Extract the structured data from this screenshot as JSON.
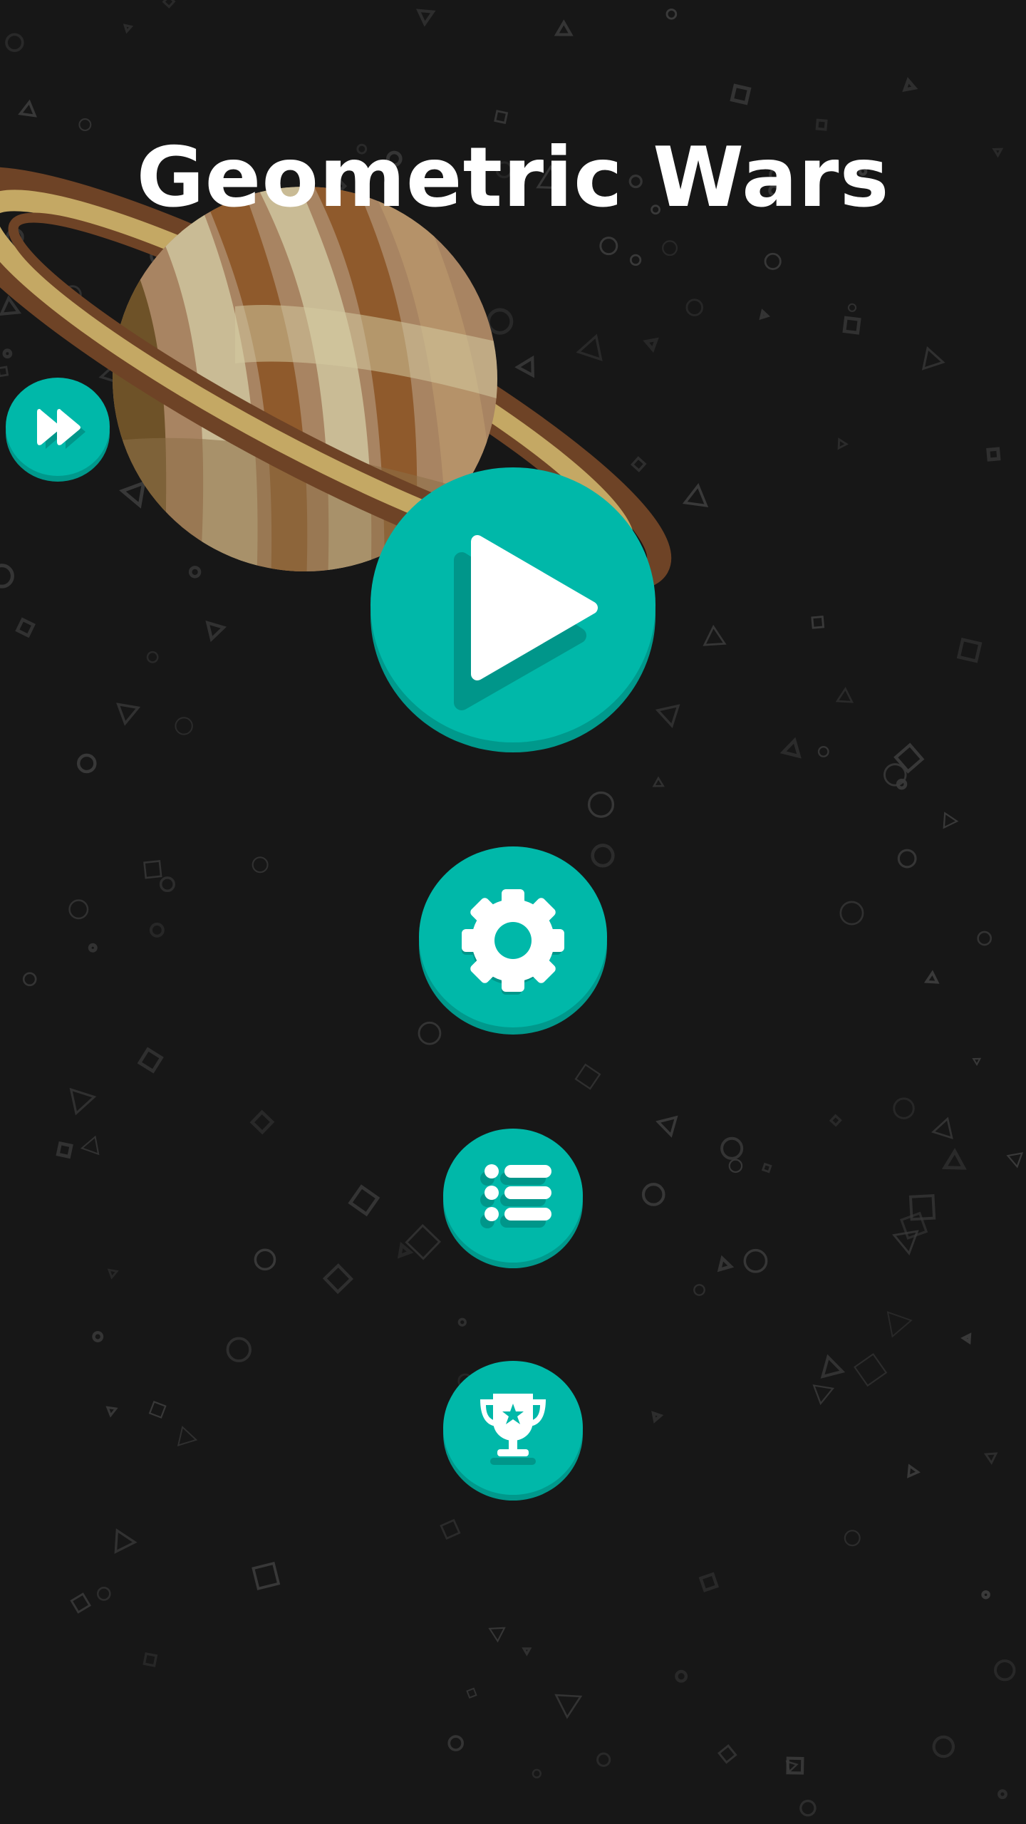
{
  "title": "Geometric Wars",
  "colors": {
    "background": "#171717",
    "button_face": "#00b8a9",
    "button_rim": "#00998c",
    "icon": "#ffffff",
    "icon_shadow": "#00968a",
    "shape_stroke": "#3a3a3a"
  },
  "buttons": {
    "play": {
      "icon": "play-icon"
    },
    "settings": {
      "icon": "gear-icon"
    },
    "levels": {
      "icon": "list-icon"
    },
    "achievements": {
      "icon": "trophy-icon"
    },
    "skip": {
      "icon": "fast-forward-icon"
    }
  },
  "decor": {
    "planet": "ringed-planet",
    "background": "floating-outlined-shapes"
  }
}
